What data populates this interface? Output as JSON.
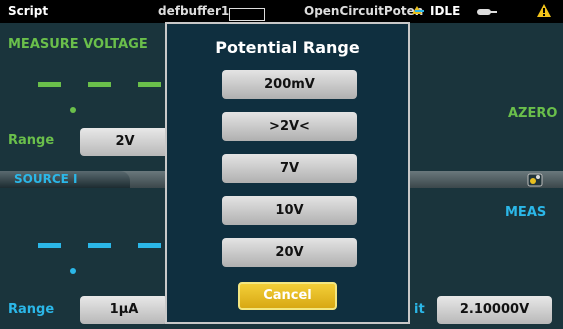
{
  "status_bar": {
    "title": "Script",
    "buffer": "defbuffer1",
    "script_name": "OpenCircuitPoten",
    "state": "IDLE"
  },
  "measure": {
    "label": "MEASURE VOLTAGE",
    "range_label": "Range",
    "range_value": "2V",
    "azero": "AZERO",
    "color": "#6abf4b"
  },
  "source": {
    "tab": "SOURCE I",
    "meas": "MEAS",
    "range_label": "Range",
    "range_value": "1μA",
    "limit_label": "it",
    "limit_value": "2.10000V",
    "color": "#2bb7e8"
  },
  "dialog": {
    "title": "Potential Range",
    "options": [
      "200mV",
      ">2V<",
      "7V",
      "10V",
      "20V"
    ],
    "cancel": "Cancel"
  },
  "icons": {
    "trigger": "user-swipe-icon",
    "link": "link-icon",
    "warning": "warning-icon",
    "source_settings": "settings-icon"
  }
}
